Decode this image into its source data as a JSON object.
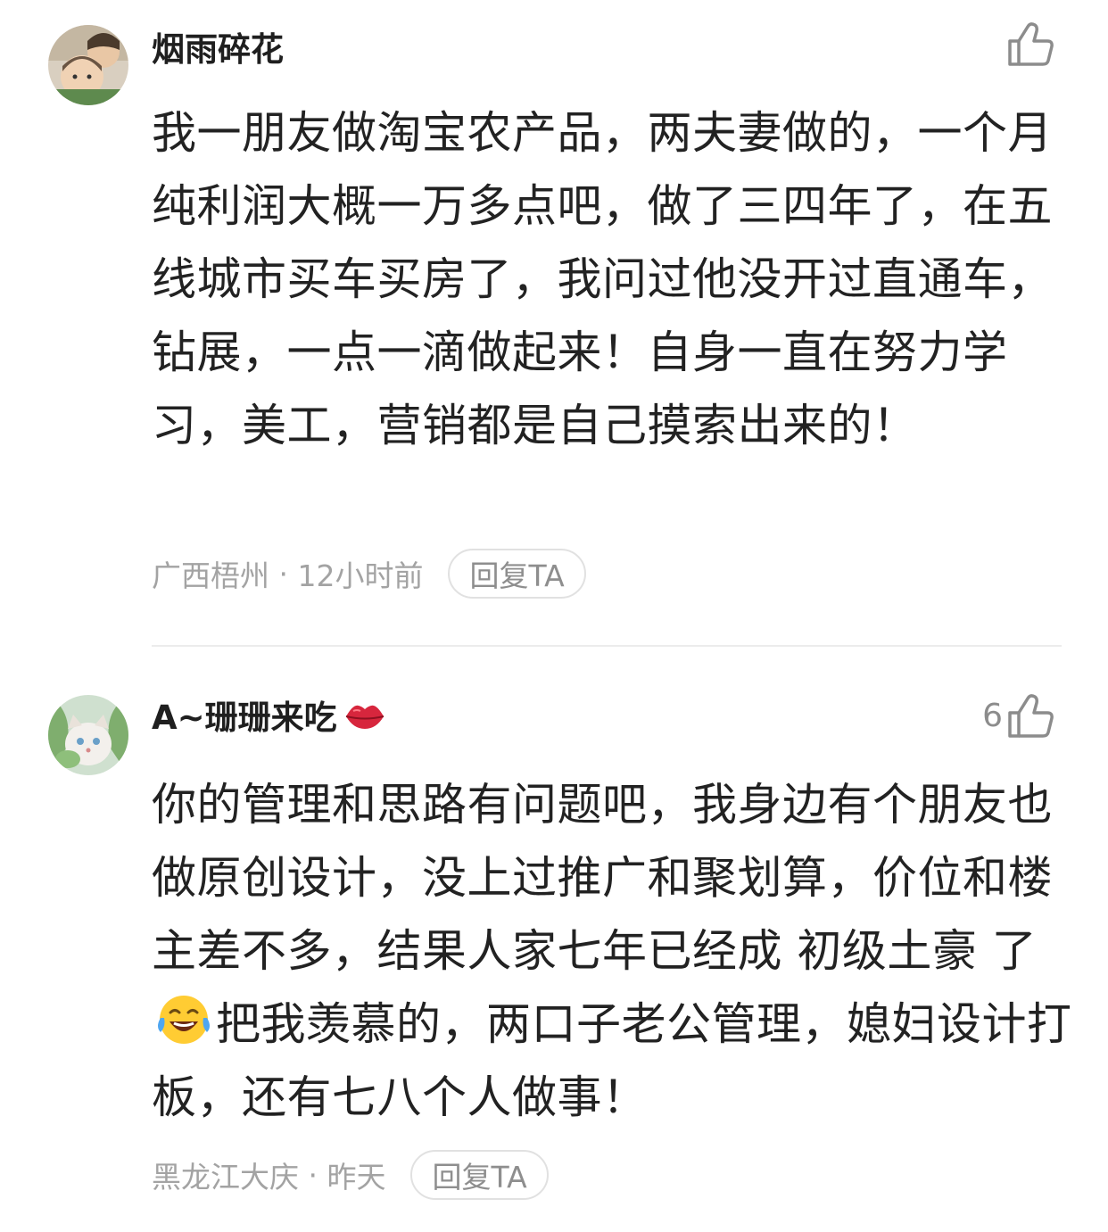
{
  "comments": [
    {
      "username": "烟雨碎花",
      "like_count": "",
      "body": "我一朋友做淘宝农产品，两夫妻做的，一个月纯利润大概一万多点吧，做了三四年了，在五线城市买车买房了，我问过他没开过直通车，钻展，一点一滴做起来！自身一直在努力学习，美工，营销都是自己摸索出来的！",
      "location": "广西梧州",
      "time": "12小时前",
      "reply_label": "回复TA"
    },
    {
      "username": "A~珊珊来吃",
      "like_count": "6",
      "body_before_emoji": "你的管理和思路有问题吧，我身边有个朋友也做原创设计，没上过推广和聚划算，价位和楼主差不多，结果人家七年已经成 初级土豪 了",
      "body_after_emoji": "把我羡慕的，两口子老公管理，媳妇设计打板，还有七八个人做事！",
      "location": "黑龙江大庆",
      "time": "昨天",
      "reply_label": "回复TA"
    }
  ],
  "separator": " · ",
  "icons": {
    "like": "thumbs-up-icon",
    "lips": "kiss-lips-emoji",
    "laugh": "tears-of-joy-emoji"
  }
}
